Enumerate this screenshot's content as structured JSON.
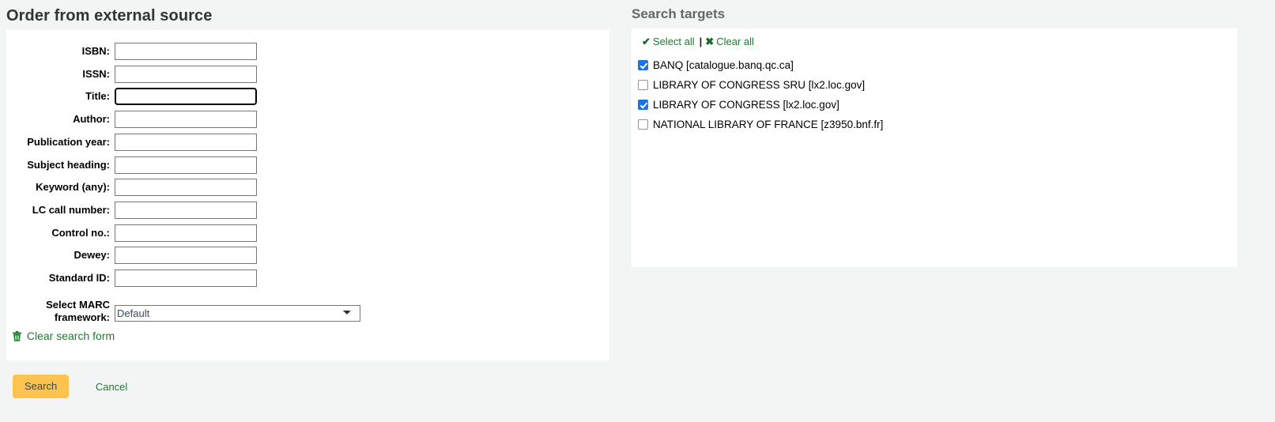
{
  "left": {
    "heading": "Order from external source",
    "fields": [
      {
        "label": "ISBN:",
        "value": "",
        "focused": false,
        "name": "isbn"
      },
      {
        "label": "ISSN:",
        "value": "",
        "focused": false,
        "name": "issn"
      },
      {
        "label": "Title:",
        "value": "",
        "focused": true,
        "name": "title"
      },
      {
        "label": "Author:",
        "value": "",
        "focused": false,
        "name": "author"
      },
      {
        "label": "Publication year:",
        "value": "",
        "focused": false,
        "name": "publication-year"
      },
      {
        "label": "Subject heading:",
        "value": "",
        "focused": false,
        "name": "subject-heading"
      },
      {
        "label": "Keyword (any):",
        "value": "",
        "focused": false,
        "name": "keyword-any"
      },
      {
        "label": "LC call number:",
        "value": "",
        "focused": false,
        "name": "lc-call-number"
      },
      {
        "label": "Control no.:",
        "value": "",
        "focused": false,
        "name": "control-no"
      },
      {
        "label": "Dewey:",
        "value": "",
        "focused": false,
        "name": "dewey"
      },
      {
        "label": "Standard ID:",
        "value": "",
        "focused": false,
        "name": "standard-id"
      }
    ],
    "framework": {
      "label_line1": "Select MARC",
      "label_line2": "framework:",
      "selected": "Default",
      "options": [
        "Default"
      ]
    },
    "clear_form": {
      "label": "Clear search form",
      "icon": "trash-icon"
    },
    "actions": {
      "search_label": "Search",
      "cancel_label": "Cancel"
    }
  },
  "right": {
    "heading": "Search targets",
    "select_all": {
      "label": "Select all",
      "icon": "check-icon"
    },
    "separator": "|",
    "clear_all": {
      "label": "Clear all",
      "icon": "cross-icon"
    },
    "targets": [
      {
        "label": "BANQ [catalogue.banq.qc.ca]",
        "checked": true
      },
      {
        "label": "LIBRARY OF CONGRESS SRU [lx2.loc.gov]",
        "checked": false
      },
      {
        "label": "LIBRARY OF CONGRESS [lx2.loc.gov]",
        "checked": true
      },
      {
        "label": "NATIONAL LIBRARY OF FRANCE [z3950.bnf.fr]",
        "checked": false
      }
    ]
  },
  "colors": {
    "page_background": "#f3f4f4",
    "panel_background": "#ffffff",
    "link_green": "#1c7a2e",
    "button_amber": "#fcc44e",
    "checkbox_blue": "#1a73e8",
    "heading_dark": "#333333",
    "heading_gray": "#666666"
  }
}
